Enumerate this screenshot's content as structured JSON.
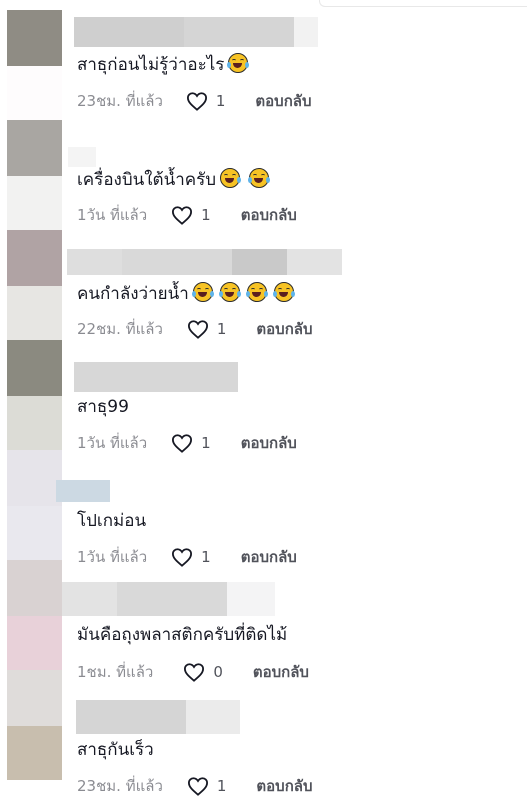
{
  "comments": [
    {
      "text": "สาธุก่อนไม่รู้ว่าอะไร",
      "emojis": [
        "laugh-cry-emoji"
      ],
      "time": "23ชม. ที่แล้ว",
      "likes": "1",
      "reply": "ตอบกลับ"
    },
    {
      "text": "เครื่องบินใต้น้ำครับ",
      "emojis": [
        "sweat-smile-emoji",
        "laugh-cry-emoji"
      ],
      "time": "1วัน ที่แล้ว",
      "likes": "1",
      "reply": "ตอบกลับ"
    },
    {
      "text": "คนกำลังว่ายน้ำ",
      "emojis": [
        "laugh-cry-emoji",
        "laugh-cry-emoji",
        "laugh-cry-emoji",
        "laugh-cry-emoji"
      ],
      "time": "22ชม. ที่แล้ว",
      "likes": "1",
      "reply": "ตอบกลับ"
    },
    {
      "text": "สาธุ99",
      "emojis": [],
      "time": "1วัน ที่แล้ว",
      "likes": "1",
      "reply": "ตอบกลับ"
    },
    {
      "text": "โปเกม่อน",
      "emojis": [],
      "time": "1วัน ที่แล้ว",
      "likes": "1",
      "reply": "ตอบกลับ"
    },
    {
      "text": "มันคือถุงพลาสติกครับที่ติดไม้",
      "emojis": [],
      "time": "1ชม. ที่แล้ว",
      "likes": "0",
      "reply": "ตอบกลับ"
    },
    {
      "text": "สาธุกันเร็ว",
      "emojis": [],
      "time": "23ชม. ที่แล้ว",
      "likes": "1",
      "reply": "ตอบกลับ"
    }
  ],
  "icons": {
    "like": "heart-outline-icon"
  },
  "colors": {
    "text": "#161823",
    "muted": "rgba(22,24,35,0.5)",
    "emoji_yellow": "#f7c325"
  }
}
